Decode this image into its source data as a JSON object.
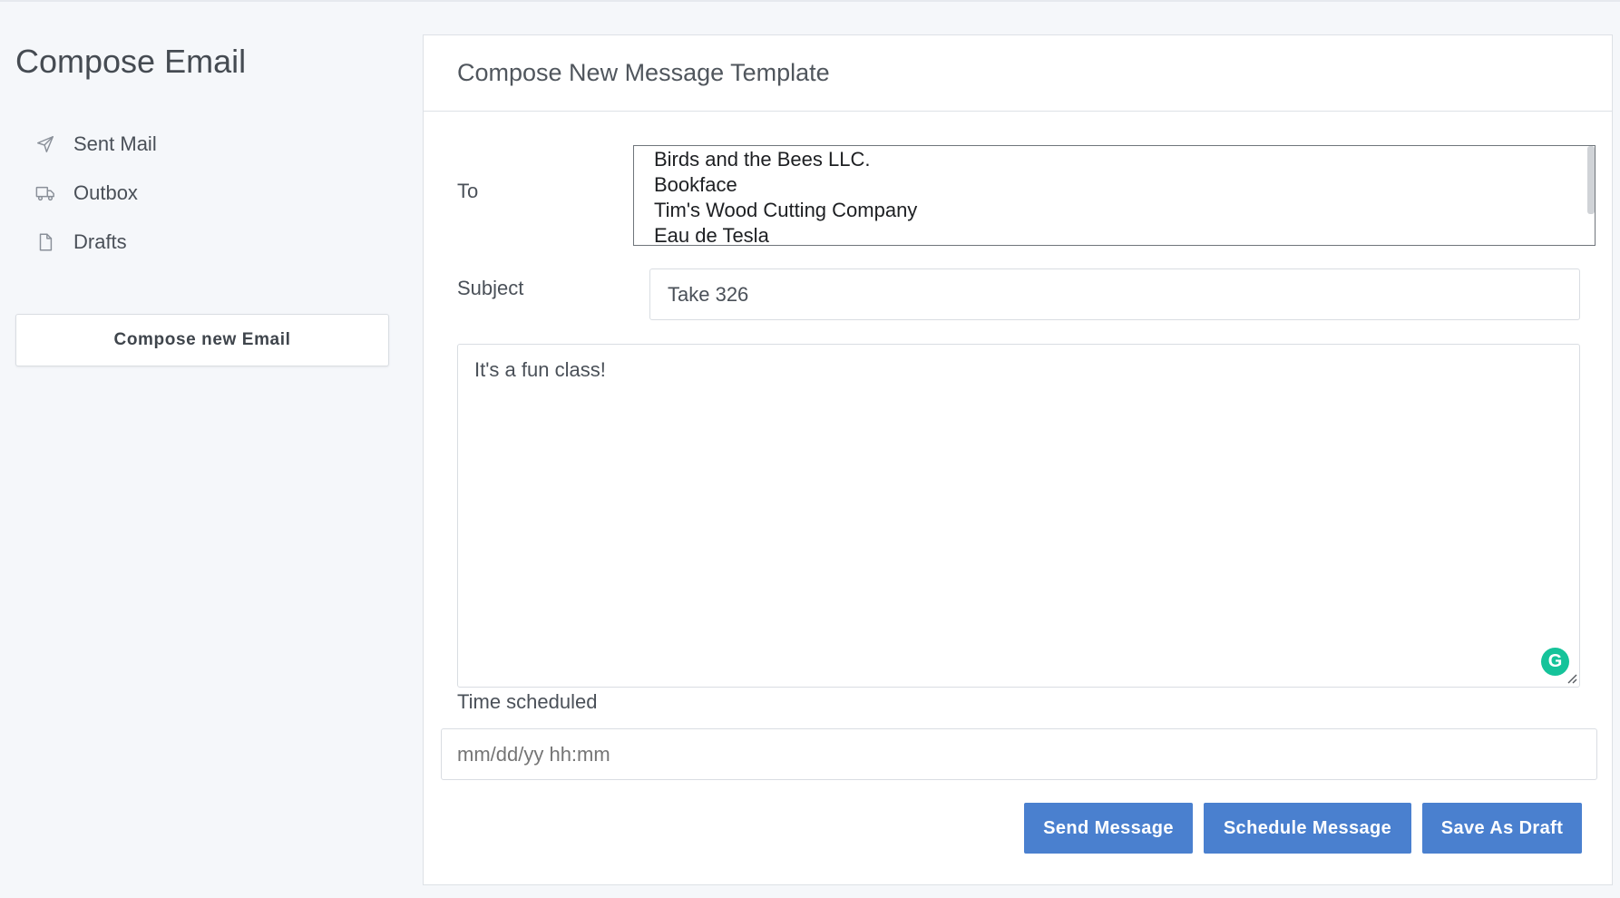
{
  "sidebar": {
    "title": "Compose Email",
    "items": [
      {
        "label": "Sent Mail",
        "icon": "send-icon"
      },
      {
        "label": "Outbox",
        "icon": "truck-icon"
      },
      {
        "label": "Drafts",
        "icon": "file-icon"
      }
    ],
    "compose_button": "Compose new Email"
  },
  "form": {
    "title": "Compose New Message Template",
    "to_label": "To",
    "recipients": [
      "Birds and the Bees LLC.",
      "Bookface",
      "Tim's Wood Cutting Company",
      "Eau de Tesla"
    ],
    "subject_label": "Subject",
    "subject_value": "Take 326",
    "body_value": "It's a fun class!",
    "grammarly_glyph": "G",
    "time_label": "Time scheduled",
    "time_placeholder": "mm/dd/yy hh:mm",
    "time_value": ""
  },
  "actions": {
    "send": "Send Message",
    "schedule": "Schedule Message",
    "draft": "Save As Draft"
  },
  "colors": {
    "primary": "#4a80cf",
    "grammarly": "#15c39a",
    "background": "#f5f7fa"
  }
}
